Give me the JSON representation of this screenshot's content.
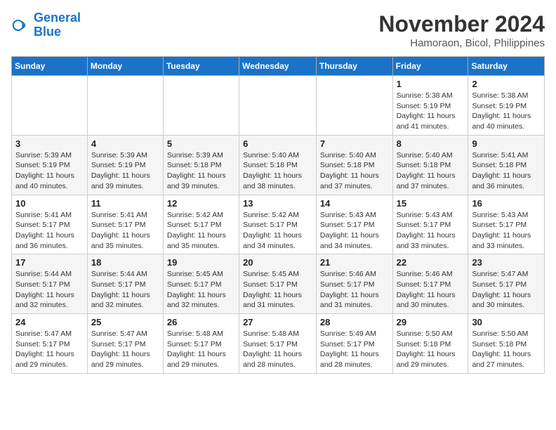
{
  "logo": {
    "line1": "General",
    "line2": "Blue"
  },
  "title": "November 2024",
  "location": "Hamoraon, Bicol, Philippines",
  "weekdays": [
    "Sunday",
    "Monday",
    "Tuesday",
    "Wednesday",
    "Thursday",
    "Friday",
    "Saturday"
  ],
  "weeks": [
    [
      null,
      null,
      null,
      null,
      null,
      {
        "day": "1",
        "sunrise": "5:38 AM",
        "sunset": "5:19 PM",
        "daylight": "11 hours and 41 minutes."
      },
      {
        "day": "2",
        "sunrise": "5:38 AM",
        "sunset": "5:19 PM",
        "daylight": "11 hours and 40 minutes."
      }
    ],
    [
      {
        "day": "3",
        "sunrise": "5:39 AM",
        "sunset": "5:19 PM",
        "daylight": "11 hours and 40 minutes."
      },
      {
        "day": "4",
        "sunrise": "5:39 AM",
        "sunset": "5:19 PM",
        "daylight": "11 hours and 39 minutes."
      },
      {
        "day": "5",
        "sunrise": "5:39 AM",
        "sunset": "5:18 PM",
        "daylight": "11 hours and 39 minutes."
      },
      {
        "day": "6",
        "sunrise": "5:40 AM",
        "sunset": "5:18 PM",
        "daylight": "11 hours and 38 minutes."
      },
      {
        "day": "7",
        "sunrise": "5:40 AM",
        "sunset": "5:18 PM",
        "daylight": "11 hours and 37 minutes."
      },
      {
        "day": "8",
        "sunrise": "5:40 AM",
        "sunset": "5:18 PM",
        "daylight": "11 hours and 37 minutes."
      },
      {
        "day": "9",
        "sunrise": "5:41 AM",
        "sunset": "5:18 PM",
        "daylight": "11 hours and 36 minutes."
      }
    ],
    [
      {
        "day": "10",
        "sunrise": "5:41 AM",
        "sunset": "5:17 PM",
        "daylight": "11 hours and 36 minutes."
      },
      {
        "day": "11",
        "sunrise": "5:41 AM",
        "sunset": "5:17 PM",
        "daylight": "11 hours and 35 minutes."
      },
      {
        "day": "12",
        "sunrise": "5:42 AM",
        "sunset": "5:17 PM",
        "daylight": "11 hours and 35 minutes."
      },
      {
        "day": "13",
        "sunrise": "5:42 AM",
        "sunset": "5:17 PM",
        "daylight": "11 hours and 34 minutes."
      },
      {
        "day": "14",
        "sunrise": "5:43 AM",
        "sunset": "5:17 PM",
        "daylight": "11 hours and 34 minutes."
      },
      {
        "day": "15",
        "sunrise": "5:43 AM",
        "sunset": "5:17 PM",
        "daylight": "11 hours and 33 minutes."
      },
      {
        "day": "16",
        "sunrise": "5:43 AM",
        "sunset": "5:17 PM",
        "daylight": "11 hours and 33 minutes."
      }
    ],
    [
      {
        "day": "17",
        "sunrise": "5:44 AM",
        "sunset": "5:17 PM",
        "daylight": "11 hours and 32 minutes."
      },
      {
        "day": "18",
        "sunrise": "5:44 AM",
        "sunset": "5:17 PM",
        "daylight": "11 hours and 32 minutes."
      },
      {
        "day": "19",
        "sunrise": "5:45 AM",
        "sunset": "5:17 PM",
        "daylight": "11 hours and 32 minutes."
      },
      {
        "day": "20",
        "sunrise": "5:45 AM",
        "sunset": "5:17 PM",
        "daylight": "11 hours and 31 minutes."
      },
      {
        "day": "21",
        "sunrise": "5:46 AM",
        "sunset": "5:17 PM",
        "daylight": "11 hours and 31 minutes."
      },
      {
        "day": "22",
        "sunrise": "5:46 AM",
        "sunset": "5:17 PM",
        "daylight": "11 hours and 30 minutes."
      },
      {
        "day": "23",
        "sunrise": "5:47 AM",
        "sunset": "5:17 PM",
        "daylight": "11 hours and 30 minutes."
      }
    ],
    [
      {
        "day": "24",
        "sunrise": "5:47 AM",
        "sunset": "5:17 PM",
        "daylight": "11 hours and 29 minutes."
      },
      {
        "day": "25",
        "sunrise": "5:47 AM",
        "sunset": "5:17 PM",
        "daylight": "11 hours and 29 minutes."
      },
      {
        "day": "26",
        "sunrise": "5:48 AM",
        "sunset": "5:17 PM",
        "daylight": "11 hours and 29 minutes."
      },
      {
        "day": "27",
        "sunrise": "5:48 AM",
        "sunset": "5:17 PM",
        "daylight": "11 hours and 28 minutes."
      },
      {
        "day": "28",
        "sunrise": "5:49 AM",
        "sunset": "5:17 PM",
        "daylight": "11 hours and 28 minutes."
      },
      {
        "day": "29",
        "sunrise": "5:50 AM",
        "sunset": "5:18 PM",
        "daylight": "11 hours and 29 minutes."
      },
      {
        "day": "30",
        "sunrise": "5:50 AM",
        "sunset": "5:18 PM",
        "daylight": "11 hours and 27 minutes."
      }
    ]
  ]
}
